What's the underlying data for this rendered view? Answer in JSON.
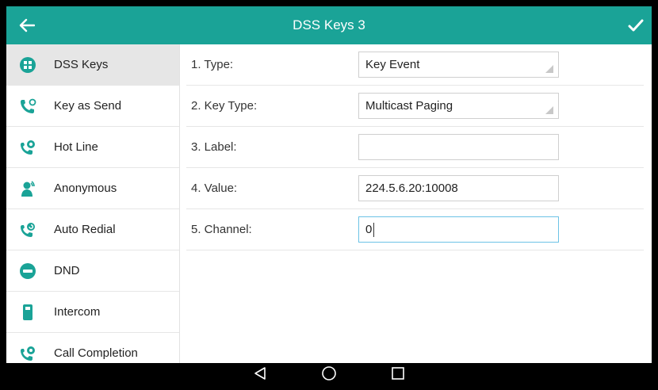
{
  "header": {
    "title": "DSS Keys 3",
    "back_icon": "arrow-left-icon",
    "confirm_icon": "checkmark-icon",
    "color": "#1aa397"
  },
  "sidebar": {
    "items": [
      {
        "label": "DSS Keys",
        "icon": "dss-keys-icon",
        "selected": true
      },
      {
        "label": "Key as Send",
        "icon": "phone-key-icon"
      },
      {
        "label": "Hot Line",
        "icon": "hotline-icon"
      },
      {
        "label": "Anonymous",
        "icon": "anonymous-icon"
      },
      {
        "label": "Auto Redial",
        "icon": "auto-redial-icon"
      },
      {
        "label": "DND",
        "icon": "dnd-icon"
      },
      {
        "label": "Intercom",
        "icon": "intercom-icon"
      },
      {
        "label": "Call Completion",
        "icon": "call-completion-icon"
      }
    ],
    "icon_color": "#1aa397"
  },
  "form": {
    "rows": [
      {
        "label": "1. Type:",
        "value": "Key Event",
        "kind": "select"
      },
      {
        "label": "2. Key Type:",
        "value": "Multicast Paging",
        "kind": "select"
      },
      {
        "label": "3. Label:",
        "value": "",
        "kind": "text"
      },
      {
        "label": "4. Value:",
        "value": "224.5.6.20:10008",
        "kind": "text"
      },
      {
        "label": "5. Channel:",
        "value": "0",
        "kind": "text",
        "focused": true
      }
    ]
  },
  "navbar": {
    "back": "nav-back-icon",
    "home": "nav-home-icon",
    "recents": "nav-recents-icon"
  }
}
